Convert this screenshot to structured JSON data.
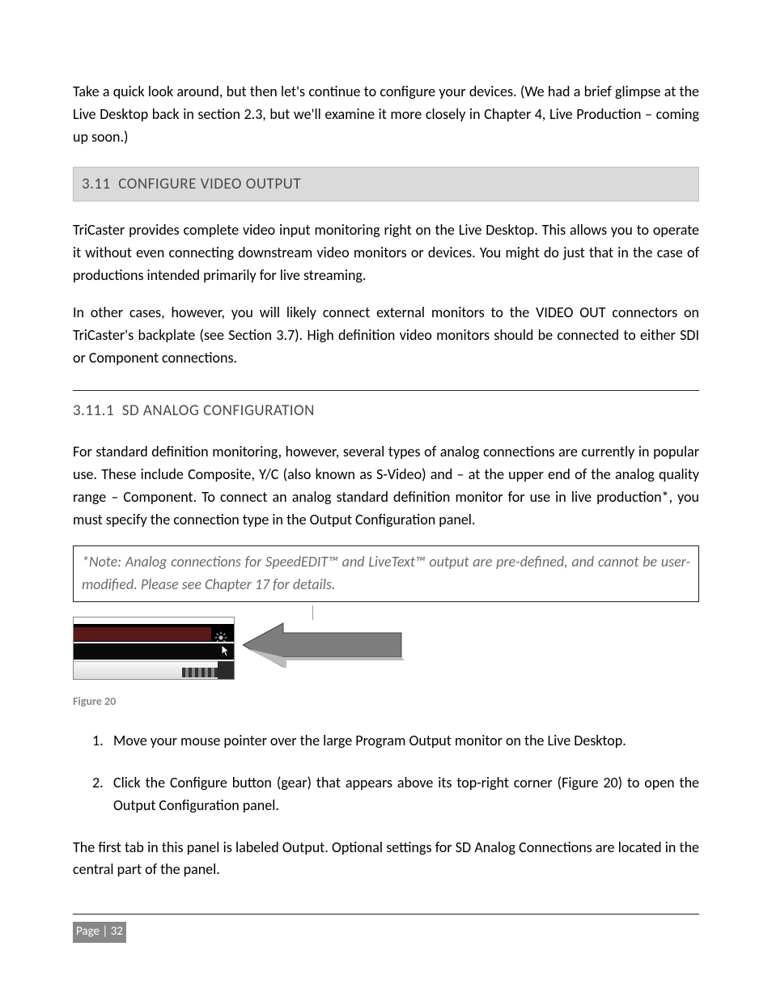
{
  "intro_paragraph": "Take a quick look around, but then let's continue to configure your devices. (We had a brief glimpse at the Live Desktop back in section 2.3, but we'll examine it more closely in Chapter 4, Live Production  – coming up soon.)",
  "section": {
    "number": "3.11",
    "title": "CONFIGURE VIDEO OUTPUT",
    "p1": "TriCaster provides complete video input monitoring right on the Live Desktop. This allows you to operate it without even connecting downstream video monitors or devices. You might do just that in the case of productions intended primarily for live streaming.",
    "p2": "In other cases, however, you will likely connect external monitors to the VIDEO OUT connectors on TriCaster's backplate (see Section 3.7). High definition video monitors should be connected to either SDI or Component connections."
  },
  "subsection": {
    "number": "3.11.1",
    "title": "SD ANALOG CONFIGURATION",
    "p1": "For standard definition monitoring, however, several types of analog connections are currently in popular use.  These include Composite, Y/C (also known as S-Video) and – at the upper end of the analog quality range – Component.  To connect an analog standard definition monitor for use in live production*, you must specify the connection type in the Output Configuration panel."
  },
  "note": "*Note: Analog connections for SpeedEDIT™ and LiveText™ output are pre-defined, and cannot be user-modified.  Please see Chapter 17 for details.",
  "figure_caption": "Figure 20",
  "steps": {
    "s1_num": "1.",
    "s1": "Move your mouse pointer over the large Program Output monitor on the Live Desktop.",
    "s2_num": "2.",
    "s2": "Click the Configure button (gear) that appears above its top-right corner (Figure 20) to open the Output Configuration panel."
  },
  "closing": "The first tab in this panel is labeled Output.  Optional settings for SD Analog Connections are located in the central part of the panel.",
  "page_label": "Page | 32"
}
